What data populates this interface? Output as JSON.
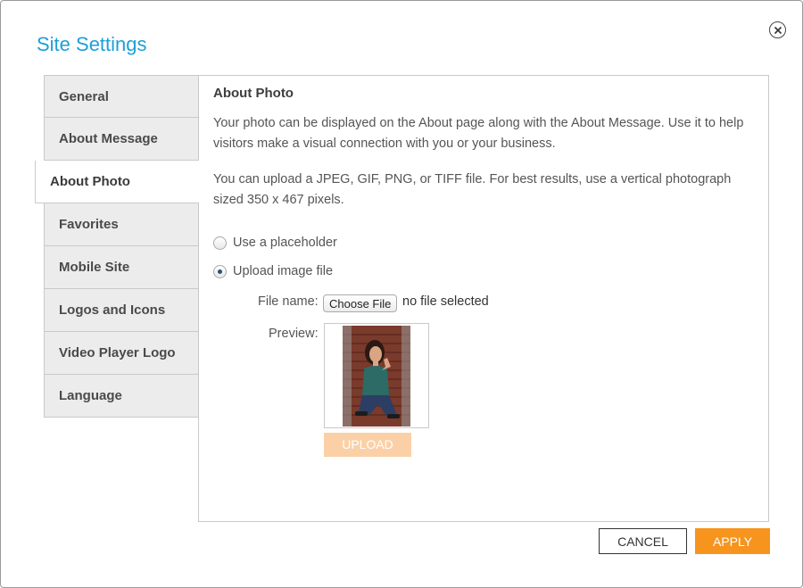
{
  "dialog": {
    "title": "Site Settings",
    "close_icon": "close-circle-icon"
  },
  "sidebar": {
    "items": [
      {
        "label": "General",
        "active": false
      },
      {
        "label": "About Message",
        "active": false
      },
      {
        "label": "About Photo",
        "active": true
      },
      {
        "label": "Favorites",
        "active": false
      },
      {
        "label": "Mobile Site",
        "active": false
      },
      {
        "label": "Logos and Icons",
        "active": false
      },
      {
        "label": "Video Player Logo",
        "active": false
      },
      {
        "label": "Language",
        "active": false
      }
    ]
  },
  "panel": {
    "heading": "About Photo",
    "paragraph1": "Your photo can be displayed on the About page along with the About Message. Use it to help visitors make a visual connection with you or your business.",
    "paragraph2": "You can upload a JPEG, GIF, PNG, or TIFF file. For best results, use a vertical photograph sized  350 x 467 pixels.",
    "options": [
      {
        "label": "Use a placeholder",
        "selected": false
      },
      {
        "label": "Upload image file",
        "selected": true
      }
    ],
    "file_name_label": "File name:",
    "choose_file_label": "Choose File",
    "file_status": "no file selected",
    "preview_label": "Preview:",
    "upload_label": "UPLOAD"
  },
  "footer": {
    "cancel_label": "CANCEL",
    "apply_label": "APPLY"
  },
  "colors": {
    "title": "#1e9fd8",
    "apply": "#f7941d",
    "upload_disabled": "#fcd0a6"
  }
}
